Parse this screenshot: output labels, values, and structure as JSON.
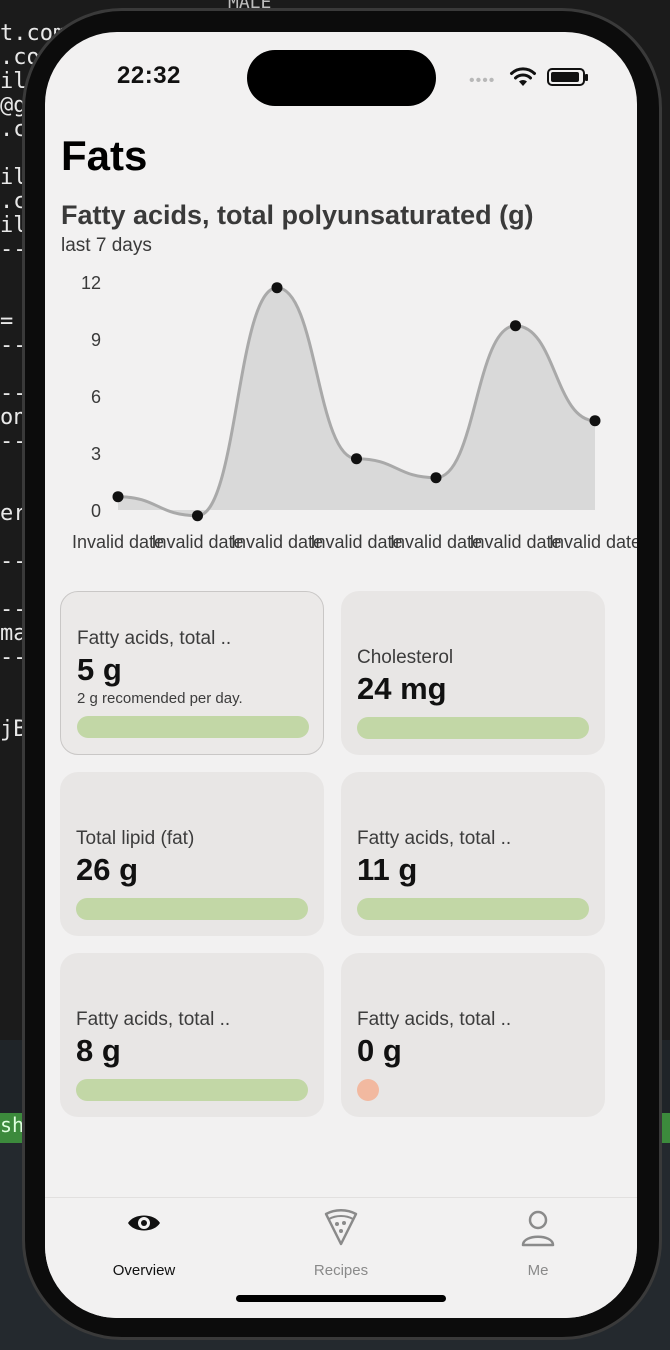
{
  "background": {
    "terminal_lines": [
      "t.com",
      ".co",
      "il",
      "@g",
      ".c",
      "",
      "il",
      ".c",
      "il",
      "--",
      "",
      "",
      "=",
      "--",
      "",
      "--",
      "on",
      "--",
      "",
      "",
      "er",
      "",
      "--",
      "",
      "--",
      "ma",
      "--",
      "",
      "",
      "jB"
    ],
    "top_label": "MALE",
    "green_tag": "sh"
  },
  "status_bar": {
    "time": "22:32",
    "signal_dots": "••••"
  },
  "page": {
    "title": "Fats"
  },
  "chart": {
    "title": "Fatty acids, total polyunsaturated (g)",
    "subtitle": "last 7 days"
  },
  "chart_data": {
    "type": "area",
    "x": [
      "Invalid date",
      "Invalid date",
      "Invalid date",
      "Invalid date",
      "Invalid date",
      "Invalid date",
      "Invalid date"
    ],
    "values": [
      0.7,
      -0.3,
      11.7,
      2.7,
      1.7,
      9.7,
      4.7
    ],
    "yticks": [
      0,
      3,
      6,
      9,
      12
    ],
    "ylim": [
      0,
      12
    ],
    "xlabel": "",
    "ylabel": "",
    "grid": false,
    "colors": {
      "fill": "#d9d9d9",
      "line": "#a9a9a9",
      "points": "#111111"
    }
  },
  "cards": [
    {
      "label": "Fatty acids, total ..",
      "value": "5 g",
      "note": "2 g recomended per day.",
      "indicator": "bar",
      "selected": true
    },
    {
      "label": "Cholesterol",
      "value": "24 mg",
      "indicator": "bar"
    },
    {
      "label": "Total lipid (fat)",
      "value": "26 g",
      "indicator": "bar"
    },
    {
      "label": "Fatty acids, total ..",
      "value": "11 g",
      "indicator": "bar"
    },
    {
      "label": "Fatty acids, total ..",
      "value": "8 g",
      "indicator": "bar"
    },
    {
      "label": "Fatty acids, total ..",
      "value": "0 g",
      "indicator": "dot"
    }
  ],
  "tabs": [
    {
      "label": "Overview",
      "icon": "eye-icon",
      "active": true
    },
    {
      "label": "Recipes",
      "icon": "pizza-icon",
      "active": false
    },
    {
      "label": "Me",
      "icon": "person-icon",
      "active": false
    }
  ],
  "colors": {
    "bar_ok": "#c2d7a6",
    "dot_low": "#f2b9a0",
    "active_tab": "#111111",
    "inactive_tab": "#8a8a8a"
  }
}
